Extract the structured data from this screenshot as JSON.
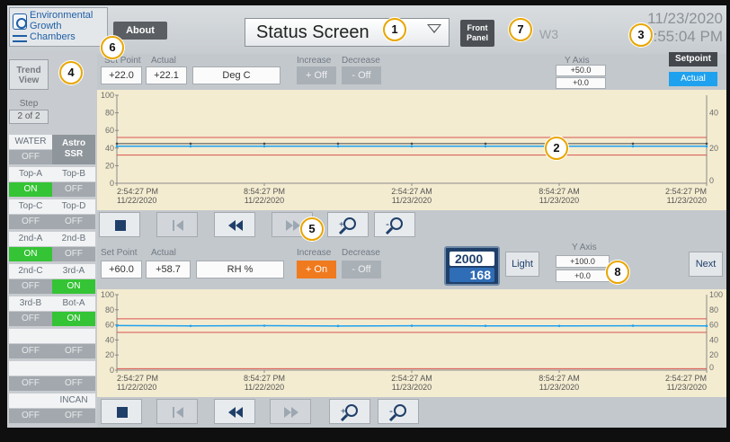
{
  "header": {
    "logo_text": "Environmental Growth Chambers",
    "about_label": "About",
    "screen_select": "Status Screen",
    "front_panel_label": "Front Panel",
    "unit_label": "W3",
    "date": "11/23/2020",
    "time": "2:55:04 PM"
  },
  "sidebar": {
    "trend_view_label": "Trend View",
    "step_label": "Step",
    "step_value": "2  of  2",
    "channels": [
      {
        "label_a": "WATER",
        "label_b": "Astro SSR",
        "state_a": "OFF",
        "state_b": ""
      },
      {
        "label_a": "Top-A",
        "label_b": "Top-B",
        "state_a": "ON",
        "state_b": "OFF"
      },
      {
        "label_a": "Top-C",
        "label_b": "Top-D",
        "state_a": "OFF",
        "state_b": "OFF"
      },
      {
        "label_a": "2nd-A",
        "label_b": "2nd-B",
        "state_a": "ON",
        "state_b": "OFF"
      },
      {
        "label_a": "2nd-C",
        "label_b": "3rd-A",
        "state_a": "OFF",
        "state_b": "ON"
      },
      {
        "label_a": "3rd-B",
        "label_b": "Bot-A",
        "state_a": "OFF",
        "state_b": "ON"
      },
      {
        "label_a": "",
        "label_b": "",
        "state_a": "OFF",
        "state_b": "OFF"
      },
      {
        "label_a": "",
        "label_b": "",
        "state_a": "OFF",
        "state_b": "OFF"
      },
      {
        "label_a": "",
        "label_b": "INCAN",
        "state_a": "OFF",
        "state_b": "OFF"
      }
    ]
  },
  "temp": {
    "setpoint_label": "Set Point",
    "actual_label": "Actual",
    "setpoint": "+22.0",
    "actual": "+22.1",
    "units": "Deg C",
    "increase_label": "Increase",
    "decrease_label": "Decrease",
    "increase_state": "+ Off",
    "decrease_state": "- Off",
    "yaxis_label": "Y Axis",
    "ymax": "+50.0",
    "ymin": "+0.0"
  },
  "legend": {
    "setpoint": "Setpoint",
    "actual": "Actual"
  },
  "rh": {
    "setpoint_label": "Set Point",
    "actual_label": "Actual",
    "setpoint": "+60.0",
    "actual": "+58.7",
    "units": "RH %",
    "increase_label": "Increase",
    "decrease_label": "Decrease",
    "increase_state": "+ On",
    "decrease_state": "- Off",
    "yaxis_label": "Y Axis",
    "ymax": "+100.0",
    "ymin": "+0.0",
    "light_top": "2000",
    "light_bottom": "168",
    "light_button": "Light",
    "next_button": "Next"
  },
  "x_ticks": [
    {
      "time": "2:54:27 PM",
      "date": "11/22/2020"
    },
    {
      "time": "8:54:27 PM",
      "date": "11/22/2020"
    },
    {
      "time": "2:54:27 AM",
      "date": "11/23/2020"
    },
    {
      "time": "8:54:27 AM",
      "date": "11/23/2020"
    },
    {
      "time": "2:54:27 PM",
      "date": "11/23/2020"
    }
  ],
  "chart_data": [
    {
      "type": "line",
      "left_axis_ticks": [
        "100",
        "80",
        "60",
        "40",
        "20",
        "0"
      ],
      "right_axis_ticks": [
        "40",
        "20",
        "0"
      ],
      "ylim": [
        0,
        100
      ],
      "series": [
        {
          "values": [
            42,
            42,
            42,
            42,
            42,
            42,
            42,
            42,
            42
          ]
        },
        {
          "values": [
            45,
            45,
            45,
            45,
            45,
            45,
            45,
            45,
            45
          ]
        }
      ],
      "bands": [
        52,
        32
      ]
    },
    {
      "type": "line",
      "left_axis_ticks": [
        "100",
        "80",
        "60",
        "40",
        "20",
        "0"
      ],
      "right_axis_ticks": [
        "100",
        "80",
        "60",
        "40",
        "20",
        "0"
      ],
      "ylim": [
        0,
        100
      ],
      "series": [
        {
          "values": [
            59,
            58.6,
            58.9,
            58.5,
            58.8,
            58.7,
            58.6,
            58.8,
            58.7
          ]
        }
      ],
      "bands": [
        68,
        50,
        2
      ]
    }
  ],
  "callouts": [
    "1",
    "2",
    "3",
    "4",
    "5",
    "6",
    "7",
    "8"
  ],
  "colors": {
    "plot_bg": "#f4ecd0",
    "actual": "#1ea1ee",
    "setpoint": "#44484c",
    "band": "#d9534f",
    "on": "#35c435",
    "off": "#a2a8ae",
    "increase_on": "#f07a1e"
  }
}
